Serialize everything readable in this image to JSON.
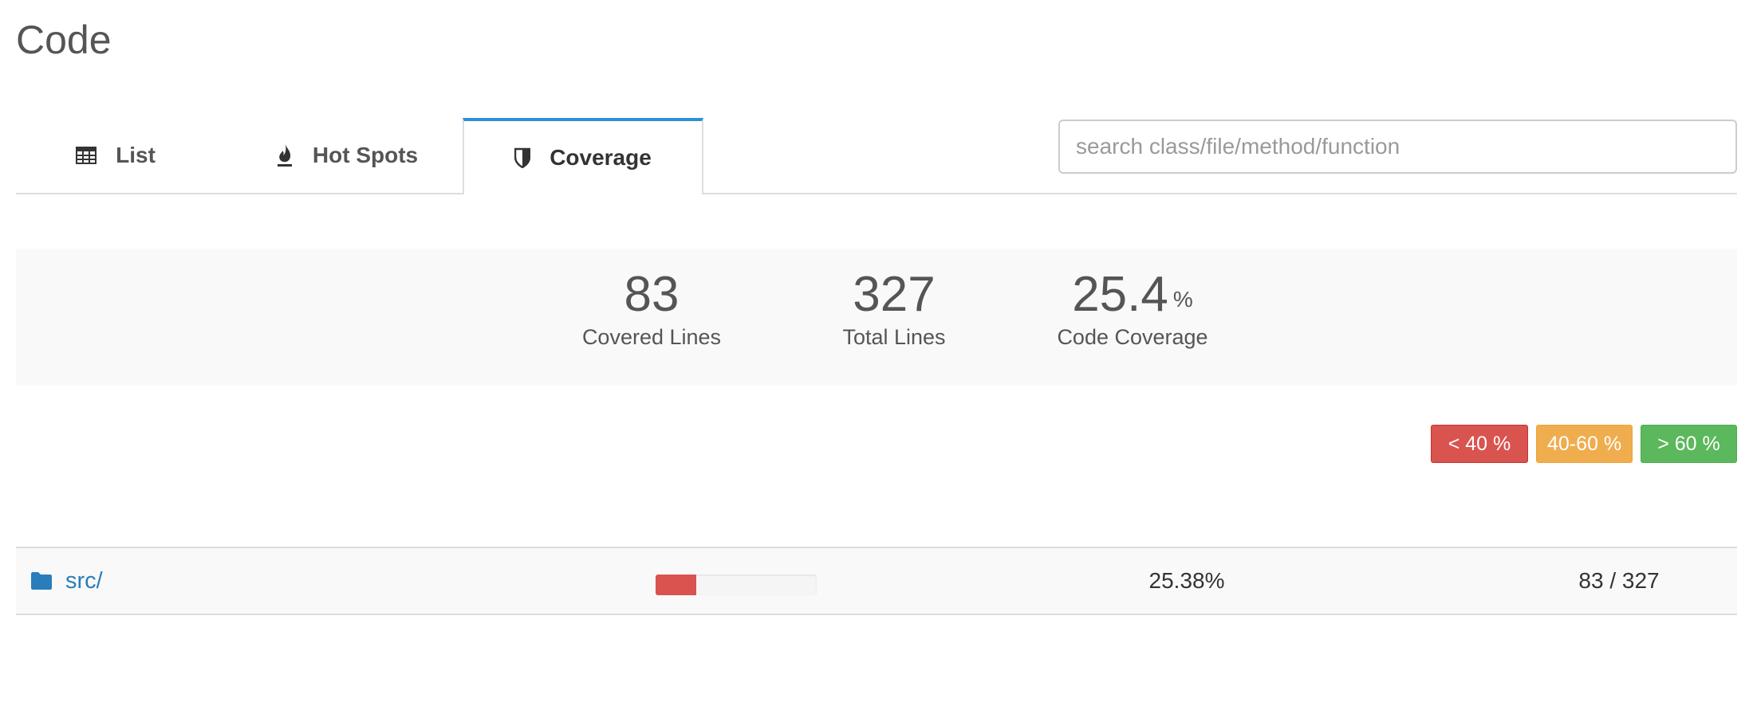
{
  "page": {
    "title": "Code"
  },
  "tabs": [
    {
      "label": "List",
      "icon": "table-icon",
      "active": false
    },
    {
      "label": "Hot Spots",
      "icon": "fire-icon",
      "active": false
    },
    {
      "label": "Coverage",
      "icon": "shield-icon",
      "active": true
    }
  ],
  "search": {
    "placeholder": "search class/file/method/function",
    "value": ""
  },
  "summary": {
    "covered": {
      "value": "83",
      "label": "Covered Lines"
    },
    "total": {
      "value": "327",
      "label": "Total Lines"
    },
    "coverage": {
      "value": "25.4",
      "unit": "%",
      "label": "Code Coverage"
    }
  },
  "legend": {
    "low": {
      "label": "< 40 %",
      "color": "#d9534f"
    },
    "mid": {
      "label": "40-60 %",
      "color": "#f0ad4e"
    },
    "high": {
      "label": "> 60 %",
      "color": "#5cb85c"
    }
  },
  "rows": [
    {
      "name": "src/",
      "icon": "folder-icon",
      "coverage_fraction": 0.2538,
      "coverage_text": "25.38%",
      "lines_text": "83 / 327",
      "bar_color": "#d9534f"
    }
  ],
  "colors": {
    "accent": "#2d8fd5",
    "link": "#2a7dbb"
  }
}
